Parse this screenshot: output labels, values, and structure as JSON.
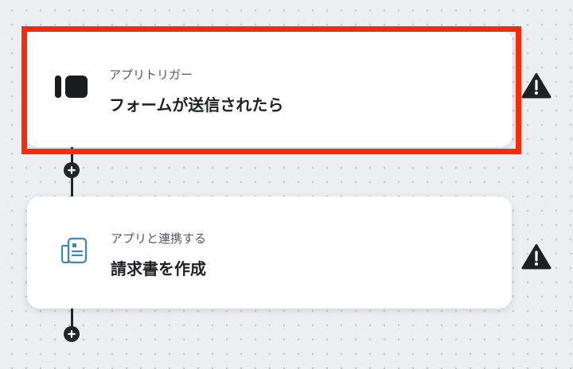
{
  "flow": {
    "steps": [
      {
        "subtitle": "アプリトリガー",
        "title": "フォームが送信されたら",
        "icon": "form-icon",
        "selected": true,
        "status_icon": "warning-icon"
      },
      {
        "subtitle": "アプリと連携する",
        "title": "請求書を作成",
        "icon": "invoice-icon",
        "selected": false,
        "status_icon": "warning-icon"
      }
    ]
  },
  "colors": {
    "selection": "#f52c0c",
    "connector": "#222428",
    "invoice_icon": "#3f86c4",
    "warning": "#1e2024"
  }
}
